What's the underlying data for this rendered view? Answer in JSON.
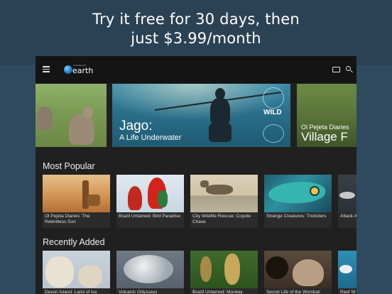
{
  "promo": {
    "line1": "Try it free for 30 days, then",
    "line2": "just $3.99/month"
  },
  "app": {
    "logo_small": "Smithsonian",
    "logo_text": "earth"
  },
  "hero": {
    "main_title": "Jago:",
    "main_subtitle": "A Life Underwater",
    "badge": "WILD",
    "right_title_line1": "Ol Pejeta Diaries",
    "right_title_line2": "Village F"
  },
  "sections": {
    "most_popular": {
      "title": "Most Popular",
      "items": [
        {
          "label": "Ol Pejeta Diaries: The Relentless Sun"
        },
        {
          "label": "Brazil Untamed: Bird Paradise"
        },
        {
          "label": "City Wildlife Rescue: Coyote Chase"
        },
        {
          "label": "Strange Creatures: Tricksters"
        },
        {
          "label": "Attack Apex P"
        }
      ]
    },
    "recently_added": {
      "title": "Recently Added",
      "items": [
        {
          "label": "Devon Island: Land of Ice"
        },
        {
          "label": "Volcanic Odysseys"
        },
        {
          "label": "Brazil Untamed: Monkey"
        },
        {
          "label": "Secret Life of the Wombat:"
        },
        {
          "label": "Reef W"
        }
      ]
    }
  },
  "icons": {
    "menu": "hamburger-menu-icon",
    "cast": "cast-icon",
    "search": "search-icon",
    "logo": "globe-logo-icon"
  },
  "colors": {
    "background": "#2f4a5f",
    "app_background": "#202020",
    "topbar": "#141414"
  }
}
